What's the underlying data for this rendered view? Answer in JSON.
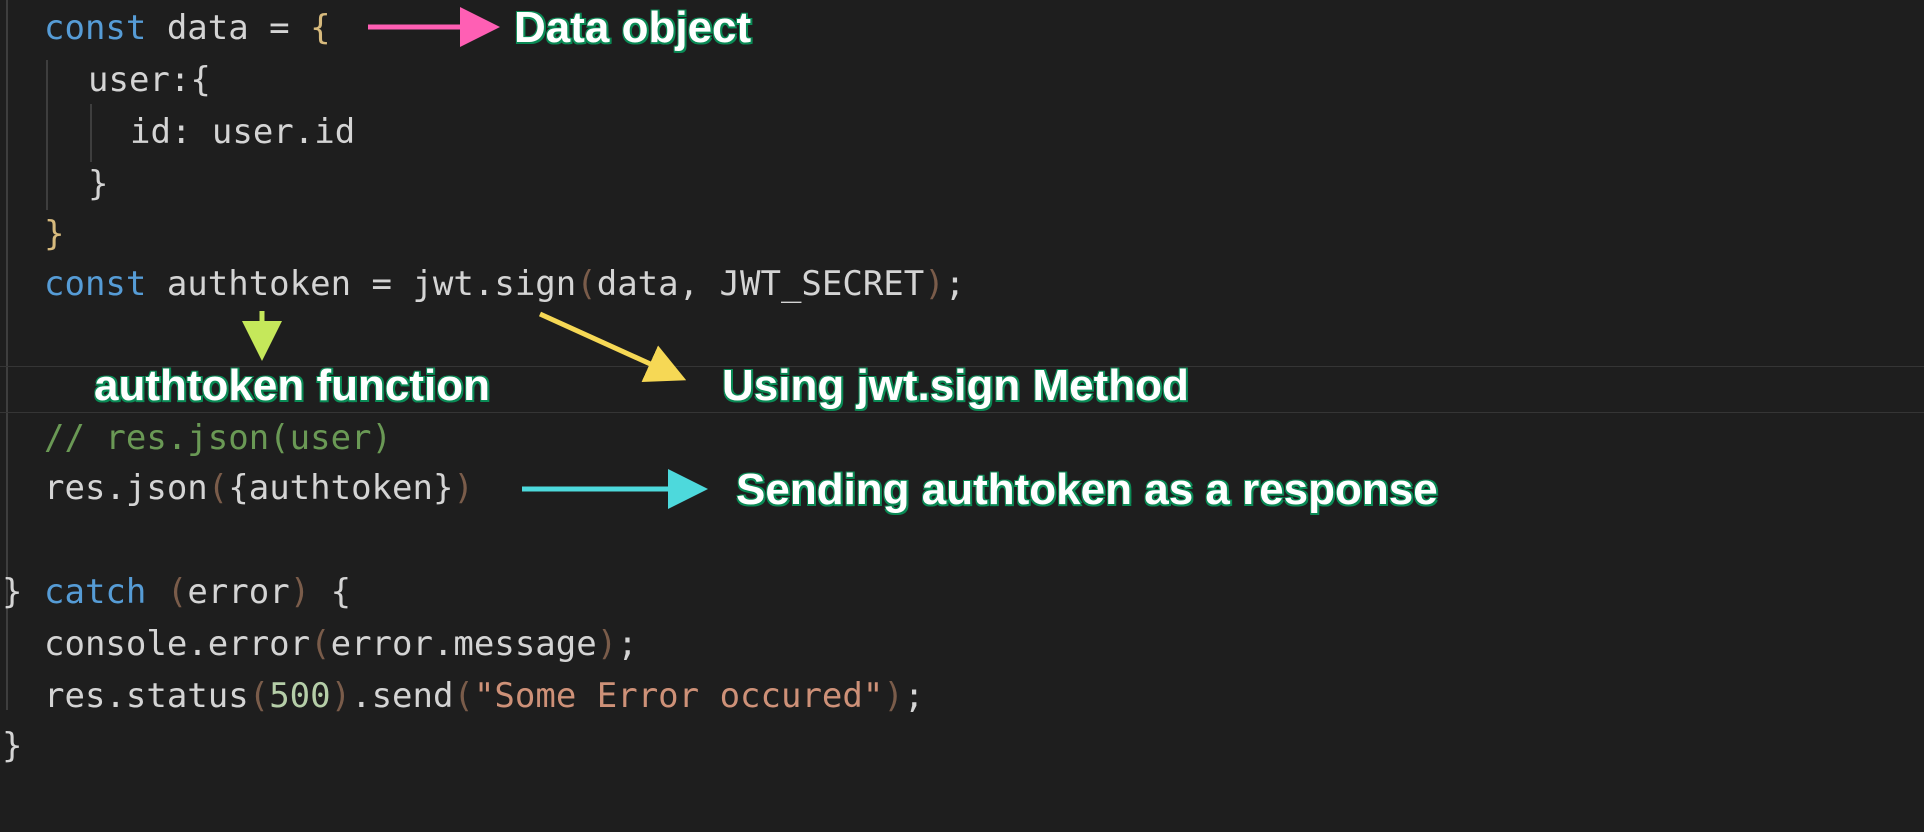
{
  "code": {
    "l1": {
      "kw": "const",
      "name": " data = ",
      "brace": "{"
    },
    "l2": {
      "text": "user:{"
    },
    "l3": {
      "text": "id: user.id"
    },
    "l4": {
      "text": "}"
    },
    "l5": {
      "brace": "}"
    },
    "l6": {
      "kw": "const",
      "mid": " authtoken = jwt.sign",
      "open": "(",
      "args": "data, JWT_SECRET",
      "close": ")",
      "end": ";"
    },
    "l8": {
      "text": "// res.json(user)"
    },
    "l9": {
      "pre": "res.json",
      "open": "(",
      "arg": "{authtoken}",
      "close": ")"
    },
    "l10": {
      "fold": "}",
      "kw": "catch",
      "open": "(",
      "arg": "error",
      "close": ")",
      "end": " {"
    },
    "l11": {
      "pre": "console.error",
      "open": "(",
      "arg": "error.message",
      "close": ")",
      "end": ";"
    },
    "l12": {
      "pre": "res.status",
      "open1": "(",
      "num": "500",
      "close1": ")",
      "mid": ".send",
      "open2": "(",
      "str": "\"Some Error occured\"",
      "close2": ")",
      "end": ";"
    },
    "l13": {
      "text": "}"
    }
  },
  "annotations": {
    "data_object": "Data object",
    "authtoken_function": "authtoken function",
    "jwt_sign": "Using jwt.sign Method",
    "sending": "Sending authtoken as a response"
  },
  "colors": {
    "background": "#1e1e1e",
    "keyword": "#569cd6",
    "comment": "#6a9955",
    "string": "#ce9178",
    "number": "#b5cea8",
    "arrow_pink": "#ff5fb4",
    "arrow_lime": "#c5e85a",
    "arrow_yellow": "#f6d855",
    "arrow_cyan": "#4dd9dc",
    "label_outline": "#0a8a55"
  },
  "icons": [
    "arrow-pink",
    "arrow-lime-down",
    "arrow-yellow-diagonal",
    "arrow-cyan"
  ]
}
